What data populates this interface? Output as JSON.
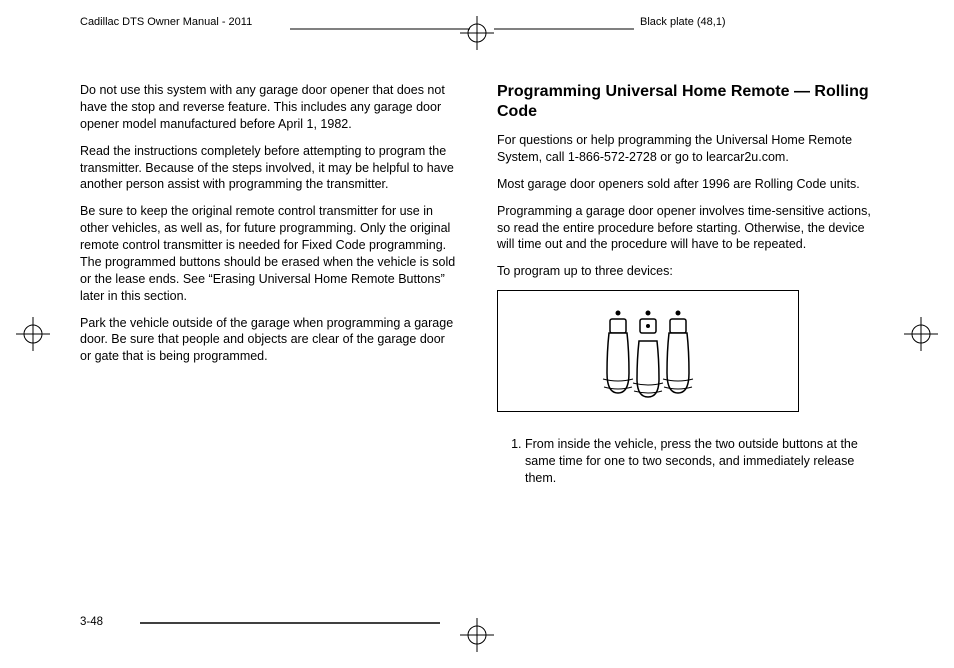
{
  "header": {
    "left": "Cadillac DTS Owner Manual - 2011",
    "right": "Black plate (48,1)"
  },
  "left_col": {
    "p1": "Do not use this system with any garage door opener that does not have the stop and reverse feature. This includes any garage door opener model manufactured before April 1, 1982.",
    "p2": "Read the instructions completely before attempting to program the transmitter. Because of the steps involved, it may be helpful to have another person assist with programming the transmitter.",
    "p3": "Be sure to keep the original remote control transmitter for use in other vehicles, as well as, for future programming. Only the original remote control transmitter is needed for Fixed Code programming. The programmed buttons should be erased when the vehicle is sold or the lease ends. See “Erasing Universal Home Remote Buttons” later in this section.",
    "p4": "Park the vehicle outside of the garage when programming a garage door. Be sure that people and objects are clear of the garage door or gate that is being programmed."
  },
  "right_col": {
    "heading": "Programming Universal Home Remote — Rolling Code",
    "p1": "For questions or help programming the Universal Home Remote System, call 1-866-572-2728 or go to learcar2u.com.",
    "p2": "Most garage door openers sold after 1996 are Rolling Code units.",
    "p3": "Programming a garage door opener involves time-sensitive actions, so read the entire procedure before starting. Otherwise, the device will time out and the procedure will have to be repeated.",
    "p4": "To program up to three devices:",
    "step1": "From inside the vehicle, press the two outside buttons at the same time for one to two seconds, and immediately release them."
  },
  "footer": {
    "page_number": "3-48"
  }
}
